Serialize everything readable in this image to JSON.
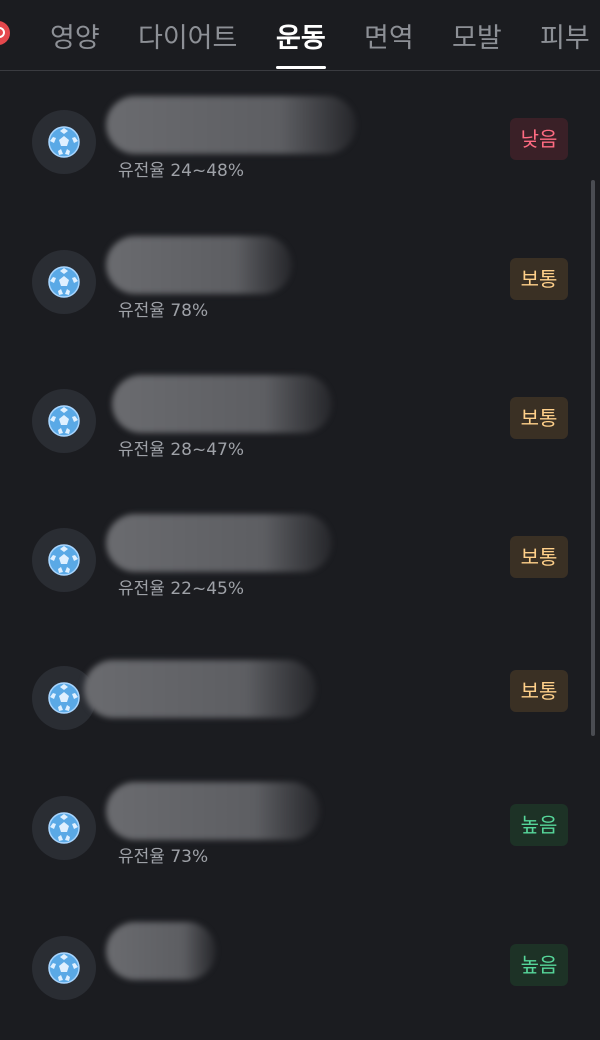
{
  "tabs": [
    "영양",
    "다이어트",
    "운동",
    "면역",
    "모발",
    "피부"
  ],
  "active_tab": "운동",
  "rows": [
    {
      "subtext": "유전율 24~48%",
      "level": "낮음",
      "level_type": "low"
    },
    {
      "subtext": "유전율 78%",
      "level": "보통",
      "level_type": "mid"
    },
    {
      "subtext": "유전율 28~47%",
      "level": "보통",
      "level_type": "mid"
    },
    {
      "subtext": "유전율 22~45%",
      "level": "보통",
      "level_type": "mid"
    },
    {
      "subtext": "",
      "level": "보통",
      "level_type": "mid"
    },
    {
      "subtext": "유전율 73%",
      "level": "높음",
      "level_type": "high"
    },
    {
      "subtext": "",
      "level": "높음",
      "level_type": "high"
    }
  ],
  "colors": {
    "background": "#1b1c20",
    "low": "#ff6b82",
    "mid": "#ffd08a",
    "high": "#56d69a",
    "icon": "#5aa9e6"
  },
  "icons": {
    "row_icon": "soccer-ball-icon",
    "notification": "notification-badge-icon"
  }
}
